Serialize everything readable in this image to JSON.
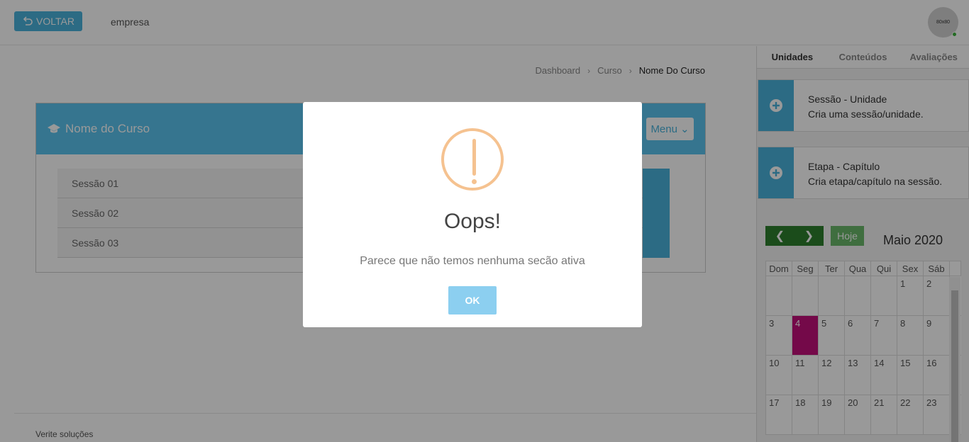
{
  "header": {
    "back_label": "VOLTAR",
    "company": "empresa",
    "avatar_text": "80x80"
  },
  "breadcrumb": [
    "Dashboard",
    "Curso",
    "Nome Do Curso"
  ],
  "course": {
    "title": "Nome do Curso",
    "menu_label": "Menu",
    "sessions": [
      "Sessão 01",
      "Sessão 02",
      "Sessão 03"
    ]
  },
  "footer": {
    "text": "Verite soluções"
  },
  "sidebar": {
    "tabs": [
      "Unidades",
      "Conteúdos",
      "Avaliações"
    ],
    "cards": [
      {
        "title": "Sessão - Unidade",
        "desc": "Cria uma sessão/unidade."
      },
      {
        "title": "Etapa - Capítulo",
        "desc": "Cria etapa/capítulo na sessão."
      }
    ]
  },
  "calendar": {
    "today_label": "Hoje",
    "title": "Maio 2020",
    "weekdays": [
      "Dom",
      "Seg",
      "Ter",
      "Qua",
      "Qui",
      "Sex",
      "Sáb"
    ],
    "weeks": [
      [
        "",
        "",
        "",
        "",
        "",
        "1",
        "2"
      ],
      [
        "3",
        "4",
        "5",
        "6",
        "7",
        "8",
        "9"
      ],
      [
        "10",
        "11",
        "12",
        "13",
        "14",
        "15",
        "16"
      ],
      [
        "17",
        "18",
        "19",
        "20",
        "21",
        "22",
        "23"
      ]
    ],
    "highlight_day": "4",
    "highlight_color": "#c1107a"
  },
  "modal": {
    "title": "Oops!",
    "text": "Parece que não temos nenhuma secão ativa",
    "ok_label": "OK"
  }
}
